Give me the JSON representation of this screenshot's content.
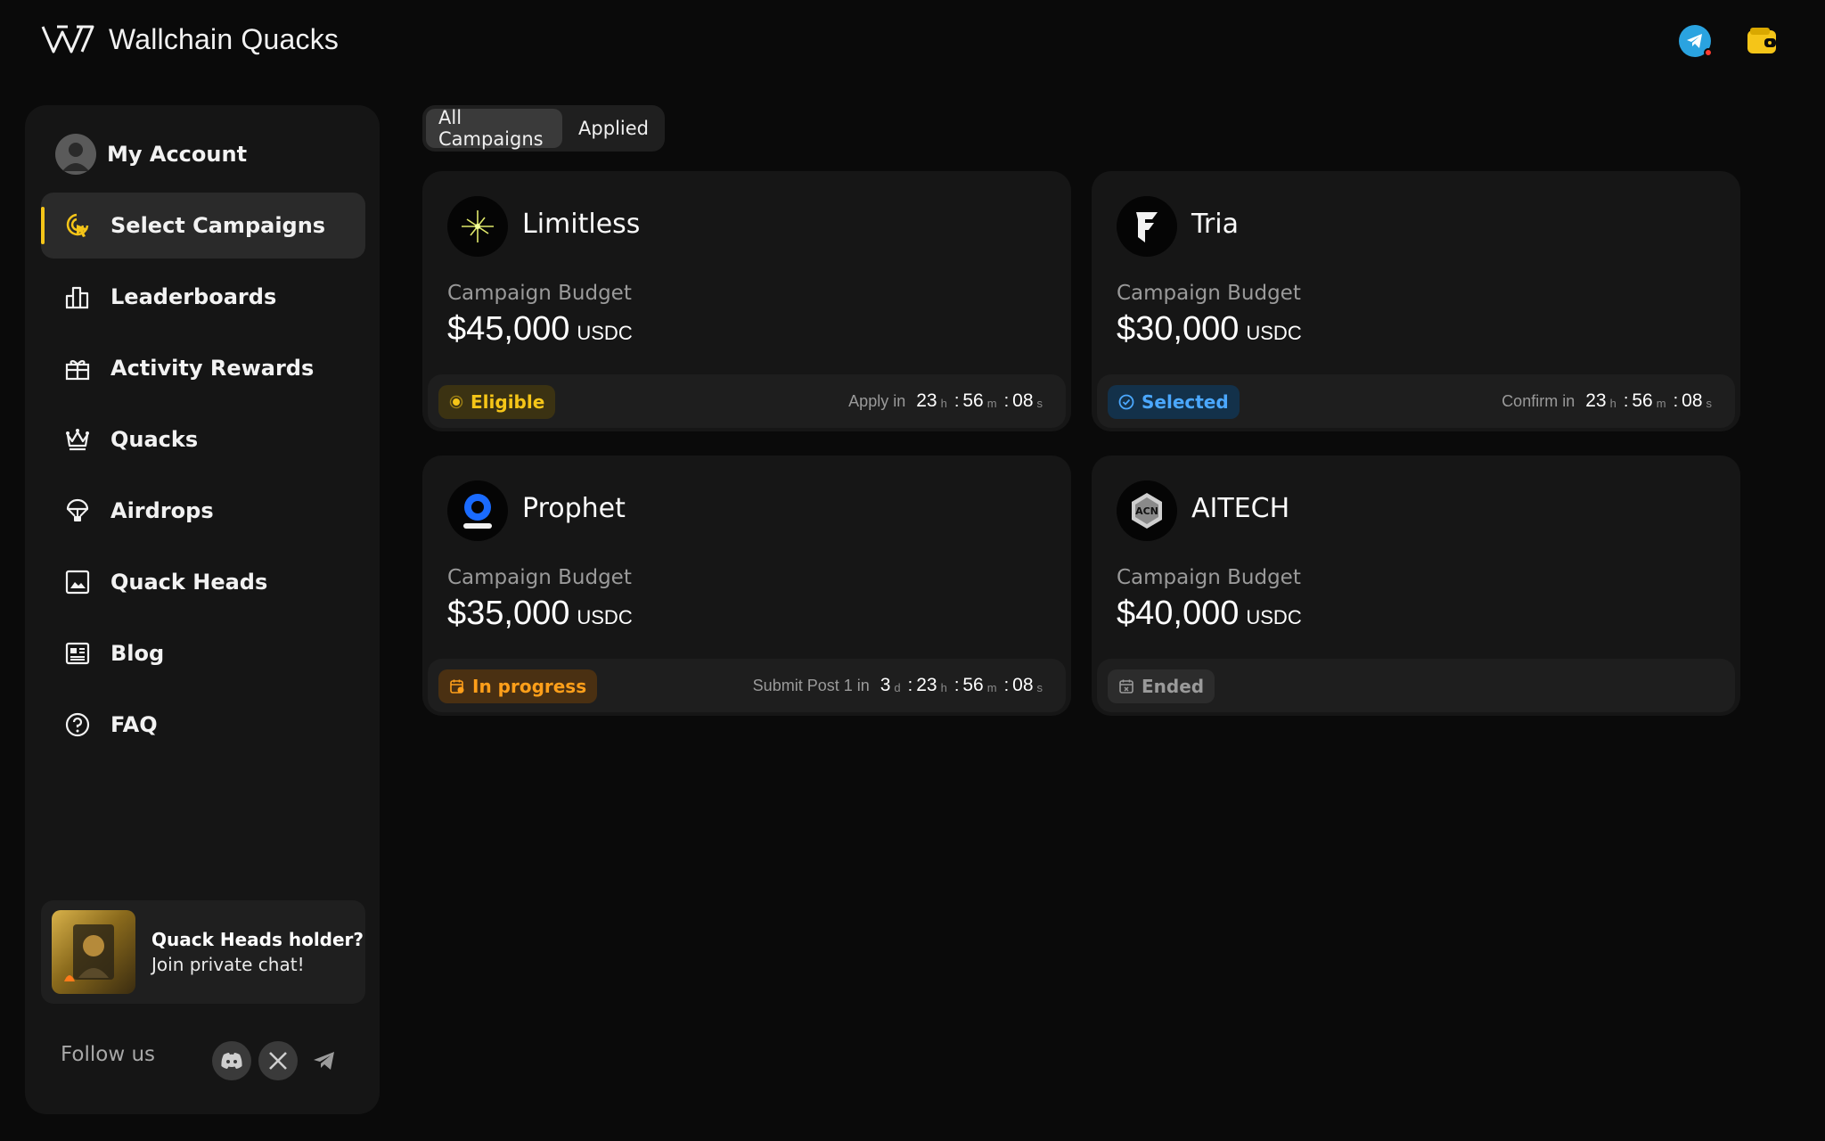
{
  "header": {
    "brand_name": "Wallchain Quacks",
    "icons": [
      "wallchain-logo",
      "telegram-icon",
      "wallet-icon"
    ],
    "telegram_notification": true
  },
  "sidebar": {
    "items": [
      {
        "label": "My Account",
        "icon": "avatar"
      },
      {
        "label": "Select Campaigns",
        "icon": "cursor-click-icon",
        "active": true
      },
      {
        "label": "Leaderboards",
        "icon": "leaderboard-icon"
      },
      {
        "label": "Activity Rewards",
        "icon": "gift-icon"
      },
      {
        "label": "Quacks",
        "icon": "crown-icon"
      },
      {
        "label": "Airdrops",
        "icon": "parachute-icon"
      },
      {
        "label": "Quack Heads",
        "icon": "image-icon"
      },
      {
        "label": "Blog",
        "icon": "newspaper-icon"
      },
      {
        "label": "FAQ",
        "icon": "question-icon"
      }
    ],
    "promo": {
      "title": "Quack Heads holder?",
      "subtitle": "Join private chat!"
    },
    "follow_label": "Follow us",
    "socials": [
      "discord-icon",
      "x-icon",
      "telegram-icon"
    ]
  },
  "tabs": [
    {
      "label": "All Campaigns",
      "active": true
    },
    {
      "label": "Applied",
      "active": false
    }
  ],
  "campaigns": [
    {
      "name": "Limitless",
      "budget_label": "Campaign Budget",
      "amount": "$45,000",
      "unit": "USDC",
      "status": "Eligible",
      "timer_label": "Apply in",
      "timer": {
        "h": "23",
        "m": "56",
        "s": "08"
      }
    },
    {
      "name": "Tria",
      "budget_label": "Campaign Budget",
      "amount": "$30,000",
      "unit": "USDC",
      "status": "Selected",
      "timer_label": "Confirm in",
      "timer": {
        "h": "23",
        "m": "56",
        "s": "08"
      }
    },
    {
      "name": "Prophet",
      "budget_label": "Campaign Budget",
      "amount": "$35,000",
      "unit": "USDC",
      "status": "In progress",
      "timer_label": "Submit Post 1 in",
      "timer": {
        "d": "3",
        "h": "23",
        "m": "56",
        "s": "08"
      }
    },
    {
      "name": "AITECH",
      "logo_text": "ACN",
      "budget_label": "Campaign Budget",
      "amount": "$40,000",
      "unit": "USDC",
      "status": "Ended"
    }
  ],
  "timer_units": {
    "d": "d",
    "h": "h",
    "m": "m",
    "s": "s"
  },
  "colors": {
    "background": "#0a0a0a",
    "panel": "#151515",
    "accent_yellow": "#f5c518",
    "selected_blue": "#4ba8ff",
    "progress_orange": "#ff9f1a",
    "ended_gray": "#9a9a9a"
  }
}
